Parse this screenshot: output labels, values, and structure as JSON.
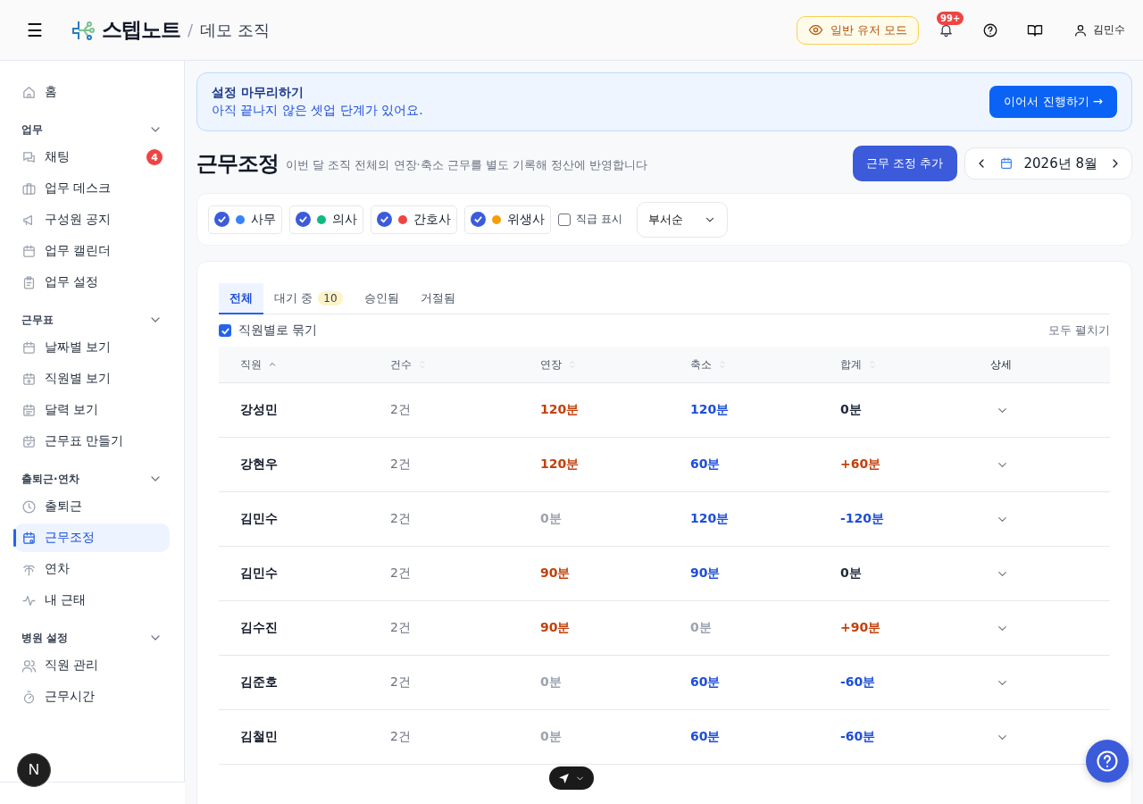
{
  "header": {
    "menu_icon": "☰",
    "brand": "스텝노트",
    "separator": "/",
    "org": "데모 조직",
    "mode_button": "일반 유저 모드",
    "notification_badge": "99+",
    "user": "김민수"
  },
  "sidebar": {
    "home": {
      "label": "홈",
      "selected": false
    },
    "sections": [
      {
        "title": "업무",
        "expanded": true,
        "items": [
          {
            "label": "채팅",
            "selected": false,
            "badge": "4"
          },
          {
            "label": "업무 데스크",
            "selected": false
          },
          {
            "label": "구성원 공지",
            "selected": false
          },
          {
            "label": "업무 캘린더",
            "selected": false
          },
          {
            "label": "업무 설정",
            "selected": false
          }
        ]
      },
      {
        "title": "근무표",
        "expanded": true,
        "items": [
          {
            "label": "날짜별 보기",
            "selected": false
          },
          {
            "label": "직원별 보기",
            "selected": false
          },
          {
            "label": "달력 보기",
            "selected": false
          },
          {
            "label": "근무표 만들기",
            "selected": false
          }
        ]
      },
      {
        "title": "출퇴근·연차",
        "expanded": true,
        "items": [
          {
            "label": "출퇴근",
            "selected": false
          },
          {
            "label": "근무조정",
            "selected": true
          },
          {
            "label": "연차",
            "selected": false
          },
          {
            "label": "내 근태",
            "selected": false
          }
        ]
      },
      {
        "title": "병원 설정",
        "expanded": true,
        "items": [
          {
            "label": "직원 관리",
            "selected": false
          },
          {
            "label": "근무시간",
            "selected": false
          }
        ]
      }
    ]
  },
  "banner": {
    "title": "설정 마무리하기",
    "message": "아직 끝나지 않은 셋업 단계가 있어요.",
    "button": "이어서 진행하기 →"
  },
  "page": {
    "title": "근무조정",
    "subtitle": "이번 달 조직 전체의 연장·축소 근무를 별도 기록해 정산에 반영합니다",
    "add_button": "근무 조정 추가",
    "month": "2026년 8월"
  },
  "filters": {
    "roles": [
      {
        "label": "사무",
        "checked": true,
        "color": "#3b82f6"
      },
      {
        "label": "의사",
        "checked": true,
        "color": "#10b981"
      },
      {
        "label": "간호사",
        "checked": true,
        "color": "#ef4444"
      },
      {
        "label": "위생사",
        "checked": true,
        "color": "#f59e0b"
      }
    ],
    "show_rank": {
      "label": "직급 표시",
      "checked": false
    },
    "sort": "부서순"
  },
  "tabs": [
    {
      "label": "전체",
      "selected": true
    },
    {
      "label": "대기 중",
      "selected": false,
      "count": "10"
    },
    {
      "label": "승인됨",
      "selected": false
    },
    {
      "label": "거절됨",
      "selected": false
    }
  ],
  "group_by_staff": {
    "label": "직원별로 묶기",
    "checked": true
  },
  "expand_all": "모두 펼치기",
  "table": {
    "columns": [
      {
        "label": "직원",
        "sortable": true,
        "sorted": true
      },
      {
        "label": "건수",
        "sortable": true,
        "sorted": false
      },
      {
        "label": "연장",
        "sortable": true,
        "sorted": false
      },
      {
        "label": "축소",
        "sortable": true,
        "sorted": false
      },
      {
        "label": "합계",
        "sortable": true,
        "sorted": false
      },
      {
        "label": "상세",
        "sortable": false
      }
    ],
    "rows": [
      {
        "name": "강성민",
        "count": "2건",
        "extension": {
          "text": "120분",
          "kind": "extension"
        },
        "reduction": {
          "text": "120분",
          "kind": "reduction"
        },
        "total": {
          "text": "0분",
          "kind": "neutral"
        }
      },
      {
        "name": "강현우",
        "count": "2건",
        "extension": {
          "text": "120분",
          "kind": "extension"
        },
        "reduction": {
          "text": "60분",
          "kind": "reduction"
        },
        "total": {
          "text": "+60분",
          "kind": "extension"
        }
      },
      {
        "name": "김민수",
        "count": "2건",
        "extension": {
          "text": "0분",
          "kind": "zero"
        },
        "reduction": {
          "text": "120분",
          "kind": "reduction"
        },
        "total": {
          "text": "-120분",
          "kind": "reduction"
        }
      },
      {
        "name": "김민수",
        "count": "2건",
        "extension": {
          "text": "90분",
          "kind": "extension"
        },
        "reduction": {
          "text": "90분",
          "kind": "reduction"
        },
        "total": {
          "text": "0분",
          "kind": "neutral"
        }
      },
      {
        "name": "김수진",
        "count": "2건",
        "extension": {
          "text": "90분",
          "kind": "extension"
        },
        "reduction": {
          "text": "0분",
          "kind": "zero"
        },
        "total": {
          "text": "+90분",
          "kind": "extension"
        }
      },
      {
        "name": "김준호",
        "count": "2건",
        "extension": {
          "text": "0분",
          "kind": "zero"
        },
        "reduction": {
          "text": "60분",
          "kind": "reduction"
        },
        "total": {
          "text": "-60분",
          "kind": "reduction"
        }
      },
      {
        "name": "김철민",
        "count": "2건",
        "extension": {
          "text": "0분",
          "kind": "zero"
        },
        "reduction": {
          "text": "60분",
          "kind": "reduction"
        },
        "total": {
          "text": "-60분",
          "kind": "reduction"
        }
      }
    ]
  },
  "floating": {
    "dev_badge": "N"
  }
}
